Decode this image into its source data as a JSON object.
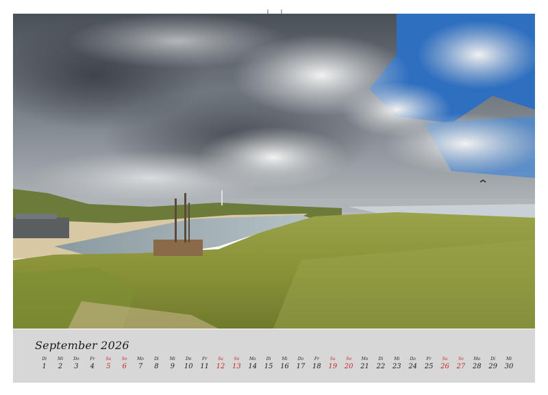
{
  "calendar": {
    "month_title": "September 2026",
    "days": [
      {
        "dow": "Di",
        "num": "1",
        "weekend": false
      },
      {
        "dow": "Mi",
        "num": "2",
        "weekend": false
      },
      {
        "dow": "Do",
        "num": "3",
        "weekend": false
      },
      {
        "dow": "Fr",
        "num": "4",
        "weekend": false
      },
      {
        "dow": "Sa",
        "num": "5",
        "weekend": true
      },
      {
        "dow": "So",
        "num": "6",
        "weekend": true
      },
      {
        "dow": "Mo",
        "num": "7",
        "weekend": false
      },
      {
        "dow": "Di",
        "num": "8",
        "weekend": false
      },
      {
        "dow": "Mi",
        "num": "9",
        "weekend": false
      },
      {
        "dow": "Do",
        "num": "10",
        "weekend": false
      },
      {
        "dow": "Fr",
        "num": "11",
        "weekend": false
      },
      {
        "dow": "Sa",
        "num": "12",
        "weekend": true
      },
      {
        "dow": "So",
        "num": "13",
        "weekend": true
      },
      {
        "dow": "Mo",
        "num": "14",
        "weekend": false
      },
      {
        "dow": "Di",
        "num": "15",
        "weekend": false
      },
      {
        "dow": "Mi",
        "num": "16",
        "weekend": false
      },
      {
        "dow": "Do",
        "num": "17",
        "weekend": false
      },
      {
        "dow": "Fr",
        "num": "18",
        "weekend": false
      },
      {
        "dow": "Sa",
        "num": "19",
        "weekend": true
      },
      {
        "dow": "So",
        "num": "20",
        "weekend": true
      },
      {
        "dow": "Mo",
        "num": "21",
        "weekend": false
      },
      {
        "dow": "Di",
        "num": "22",
        "weekend": false
      },
      {
        "dow": "Mi",
        "num": "23",
        "weekend": false
      },
      {
        "dow": "Do",
        "num": "24",
        "weekend": false
      },
      {
        "dow": "Fr",
        "num": "25",
        "weekend": false
      },
      {
        "dow": "Sa",
        "num": "26",
        "weekend": true
      },
      {
        "dow": "So",
        "num": "27",
        "weekend": true
      },
      {
        "dow": "Mo",
        "num": "28",
        "weekend": false
      },
      {
        "dow": "Di",
        "num": "29",
        "weekend": false
      },
      {
        "dow": "Mi",
        "num": "30",
        "weekend": false
      }
    ]
  },
  "colors": {
    "weekend": "#c8282a",
    "weekday": "#222222",
    "panel": "#d7d7d7"
  }
}
